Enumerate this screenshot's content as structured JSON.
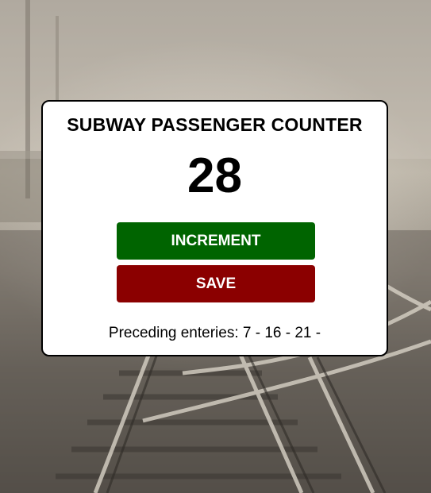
{
  "app": {
    "title": "SUBWAY PASSENGER COUNTER",
    "count": "28",
    "increment_label": "INCREMENT",
    "save_label": "SAVE",
    "preceding_label": "Preceding enteries: 7 - 16 - 21 -"
  },
  "colors": {
    "increment_button": "#006400",
    "save_button": "#8b0000",
    "card_background": "#ffffff",
    "card_border": "#000000"
  },
  "background": {
    "icon": "railway-tracks-photo"
  }
}
